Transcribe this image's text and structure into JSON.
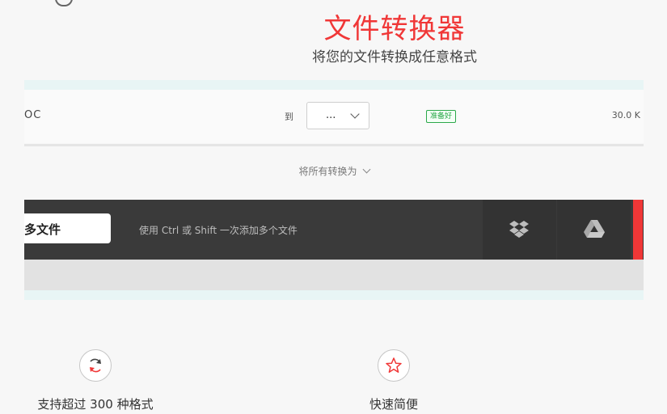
{
  "header": {
    "title": "文件转换器",
    "subtitle": "将您的文件转换成任意格式"
  },
  "file_row": {
    "extension": "OC",
    "to_label": "到",
    "format_select_value": "...",
    "status_badge": "准备好",
    "file_size": "30.0 K"
  },
  "convert_all": {
    "label": "将所有转换为"
  },
  "toolbar": {
    "add_files_label": "多文件",
    "hint": "使用 Ctrl 或 Shift 一次添加多个文件",
    "cloud_sources": [
      "dropbox-icon",
      "google-drive-icon"
    ]
  },
  "features": [
    {
      "icon": "refresh-icon",
      "label": "支持超过 300 种格式"
    },
    {
      "icon": "star-icon",
      "label": "快速简便"
    }
  ],
  "colors": {
    "brand_red": "#f03737",
    "toolbar_dark": "#3a3a3a",
    "status_green": "#2ba84a"
  }
}
